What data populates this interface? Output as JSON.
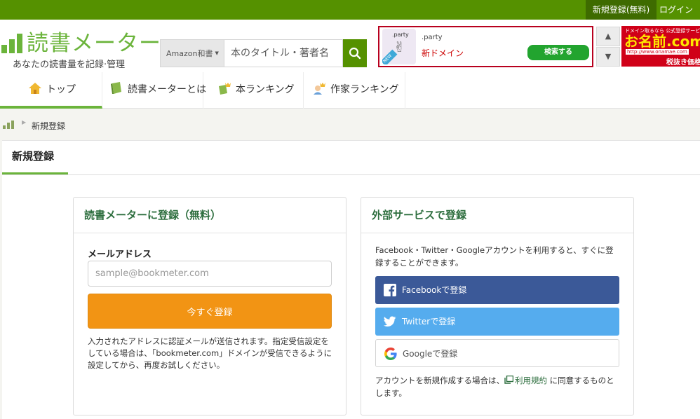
{
  "topbar": {
    "register": "新規登録(無料)",
    "login": "ログイン"
  },
  "logo": {
    "name": "読書メーター",
    "tagline": "あなたの読書量を記録·管理"
  },
  "search": {
    "category": "Amazon和書",
    "placeholder": "本のタイトル・著者名"
  },
  "ad": {
    "badge": "NEW",
    "image_label": ".party",
    "domain": ".party",
    "name": "新ドメイン",
    "button": "検索する",
    "side_line1": "ドメイン取るなら 公式登録サービス",
    "side_brand": "お名前.com",
    "side_url": "http://www.onamae.com",
    "side_tail": "税抜き価格"
  },
  "nav": {
    "items": [
      {
        "label": "トップ"
      },
      {
        "label": "読書メーターとは"
      },
      {
        "label": "本ランキング"
      },
      {
        "label": "作家ランキング"
      }
    ]
  },
  "breadcrumb": {
    "current": "新規登録"
  },
  "page": {
    "tab": "新規登録"
  },
  "signup": {
    "title": "読書メーターに登録（無料）",
    "email_label": "メールアドレス",
    "email_placeholder": "sample@bookmeter.com",
    "submit": "今すぐ登録",
    "note": "入力されたアドレスに認証メールが送信されます。指定受信設定をしている場合は、「bookmeter.com」ドメインが受信できるように設定してから、再度お試しください。"
  },
  "external": {
    "title": "外部サービスで登録",
    "description": "Facebook・Twitter・Googleアカウントを利用すると、すぐに登録することができます。",
    "facebook": "Facebookで登録",
    "twitter": "Twitterで登録",
    "google": "Googleで登録",
    "terms_before": "アカウントを新規作成する場合は、",
    "terms_link": "利用規約",
    "terms_after": "に同意するものとします。"
  },
  "colors": {
    "brand_green": "#559100",
    "logo_green": "#6bb43b",
    "heading_green": "#2d6e3e",
    "orange": "#f29414",
    "facebook": "#3b5998",
    "twitter": "#55acee"
  }
}
